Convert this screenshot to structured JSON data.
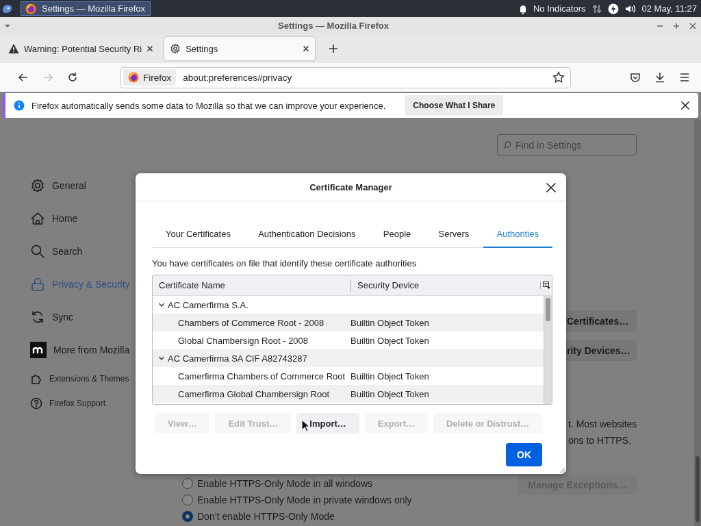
{
  "taskbar": {
    "task": {
      "label": "Settings — Mozilla Firefox",
      "selected": true
    },
    "indicator": "No Indicators",
    "clock": "02 May, 11:27"
  },
  "window": {
    "title": "Settings — Mozilla Firefox"
  },
  "tabs": [
    {
      "label": "Warning: Potential Security Ri",
      "kind": "warning",
      "selected": false
    },
    {
      "label": "Settings",
      "kind": "settings",
      "selected": true
    }
  ],
  "navbar": {
    "buttons": [
      {
        "kind": "back",
        "disabled": false
      },
      {
        "kind": "forward",
        "disabled": true
      },
      {
        "kind": "reload",
        "disabled": false
      }
    ],
    "identity": "Firefox",
    "url": "about:preferences#privacy"
  },
  "notification": {
    "message": "Firefox automatically sends some data to Mozilla so that we can improve your experience.",
    "button": "Choose What I Share"
  },
  "settings": {
    "search": {
      "placeholder": "Find in Settings"
    },
    "sidebar": {
      "items": [
        {
          "label": "General",
          "kind": "general",
          "selected": false
        },
        {
          "label": "Home",
          "kind": "home",
          "selected": false
        },
        {
          "label": "Search",
          "kind": "search",
          "selected": false
        },
        {
          "label": "Privacy & Security",
          "kind": "privacy",
          "selected": true
        },
        {
          "label": "Sync",
          "kind": "sync",
          "selected": false
        },
        {
          "label": "More from Mozilla",
          "kind": "mozilla",
          "selected": false
        }
      ],
      "footer": [
        {
          "label": "Extensions & Themes",
          "kind": "extensions"
        },
        {
          "label": "Firefox Support",
          "kind": "support"
        }
      ]
    },
    "buttons": [
      "Certificates…",
      "rity Devices…"
    ],
    "text_lines": [
      "t. Most websites",
      "ons to HTTPS."
    ],
    "https_options": [
      {
        "label": "Enable HTTPS-Only Mode in all windows",
        "selected": false
      },
      {
        "label": "Enable HTTPS-Only Mode in private windows only",
        "selected": false
      },
      {
        "label": "Don’t enable HTTPS-Only Mode",
        "selected": true
      }
    ],
    "manage_button": {
      "label": "Manage Exceptions…",
      "disabled": true
    }
  },
  "dialog": {
    "title": "Certificate Manager",
    "tabs": [
      {
        "label": "Your Certificates",
        "selected": false
      },
      {
        "label": "Authentication Decisions",
        "selected": false
      },
      {
        "label": "People",
        "selected": false
      },
      {
        "label": "Servers",
        "selected": false
      },
      {
        "label": "Authorities",
        "selected": true
      }
    ],
    "description": "You have certificates on file that identify these certificate authorities",
    "columns": [
      "Certificate Name",
      "Security Device"
    ],
    "groups": [
      {
        "name": "AC Camerfirma S.A.",
        "expanded": true,
        "children": [
          {
            "name": "Chambers of Commerce Root - 2008",
            "device": "Builtin Object Token"
          },
          {
            "name": "Global Chambersign Root - 2008",
            "device": "Builtin Object Token"
          }
        ]
      },
      {
        "name": "AC Camerfirma SA CIF A82743287",
        "expanded": true,
        "children": [
          {
            "name": "Camerfirma Chambers of Commerce Root",
            "device": "Builtin Object Token"
          },
          {
            "name": "Camerfirma Global Chambersign Root",
            "device": "Builtin Object Token"
          }
        ]
      }
    ],
    "buttons": [
      {
        "label": "View…",
        "disabled": true
      },
      {
        "label": "Edit Trust…",
        "disabled": true
      },
      {
        "label": "Import…",
        "disabled": false
      },
      {
        "label": "Export…",
        "disabled": true
      },
      {
        "label": "Delete or Distrust…",
        "disabled": true
      }
    ],
    "ok": "OK"
  }
}
